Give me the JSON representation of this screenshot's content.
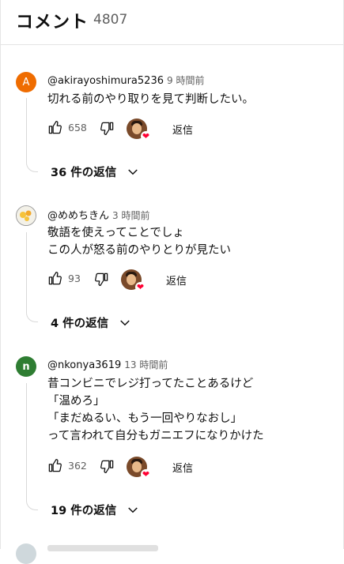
{
  "header": {
    "title": "コメント",
    "count": "4807"
  },
  "comments": [
    {
      "avatar_letter": "A",
      "author": "@akirayoshimura5236",
      "time": "9 時間前",
      "lines": [
        "切れる前のやり取りを見て判断したい。"
      ],
      "likes": "658",
      "reply_label": "返信",
      "replies_label": "36 件の返信"
    },
    {
      "avatar_letter": "",
      "author": "@めめちきん",
      "time": "3 時間前",
      "lines": [
        "敬語を使えってことでしょ",
        "この人が怒る前のやりとりが見たい"
      ],
      "likes": "93",
      "reply_label": "返信",
      "replies_label": "4 件の返信"
    },
    {
      "avatar_letter": "n",
      "author": "@nkonya3619",
      "time": "13 時間前",
      "lines": [
        "昔コンビニでレジ打ってたことあるけど",
        "「温めろ」",
        "「まだぬるい、もう一回やりなおし」",
        "って言われて自分もガニエフになりかけた"
      ],
      "likes": "362",
      "reply_label": "返信",
      "replies_label": "19 件の返信"
    }
  ],
  "colors": {
    "avatar_a": "#ef6c00",
    "avatar_n": "#2e7d32",
    "heart": "#ff0033"
  },
  "icons": [
    "thumbs-up-icon",
    "thumbs-down-icon",
    "chevron-down-icon",
    "heart-icon"
  ]
}
